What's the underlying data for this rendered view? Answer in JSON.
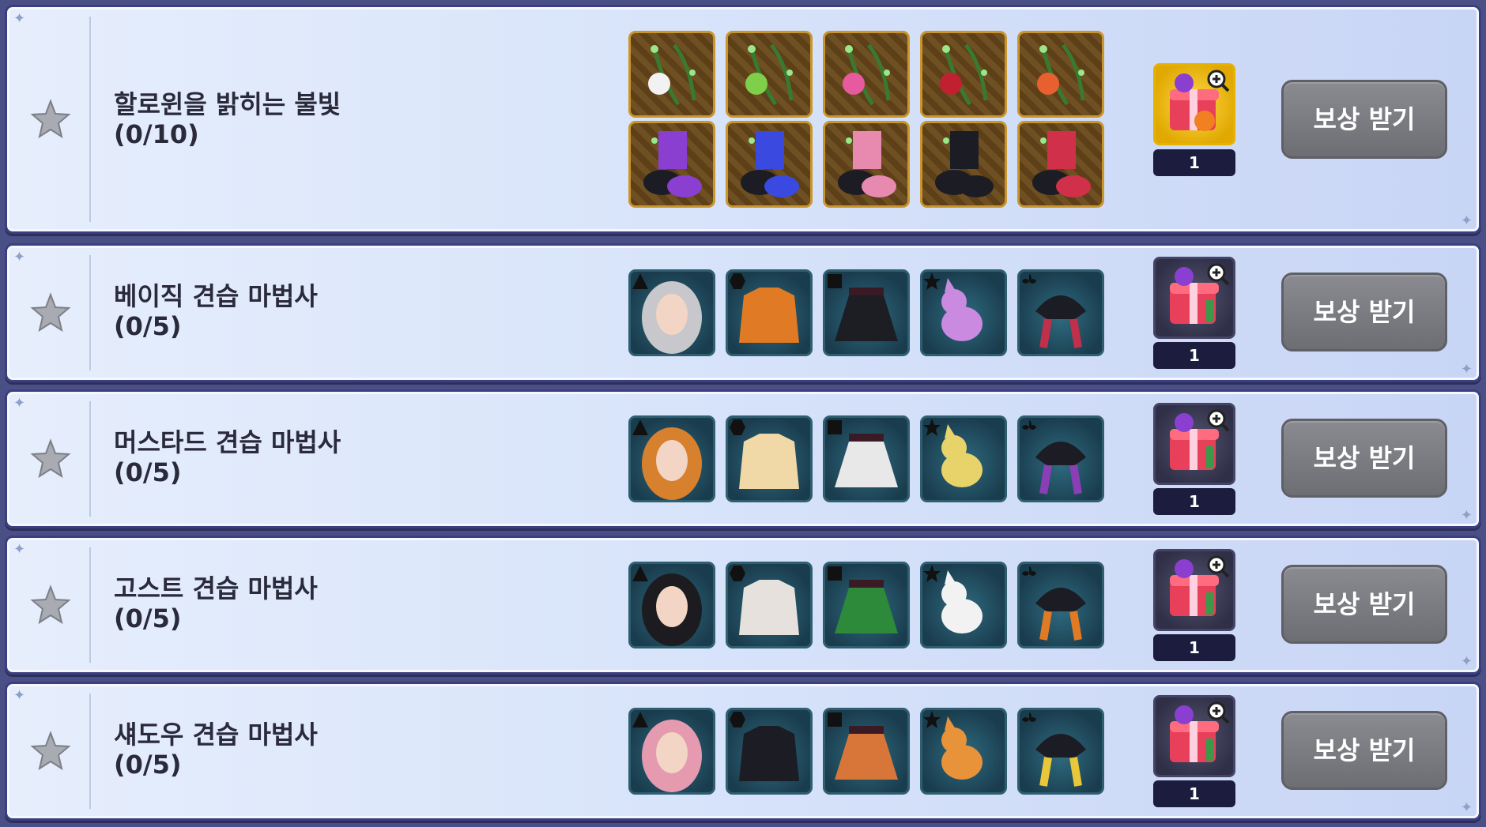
{
  "missions": [
    {
      "title": "할로윈을 밝히는 불빛",
      "progress": "(0/10)",
      "reward_count": "1",
      "claim_label": "보상 받기",
      "item_icons": [
        "lantern-vine-icon-white",
        "lantern-vine-icon-green",
        "lantern-vine-icon-pink",
        "lantern-vine-icon-red",
        "lantern-vine-icon-orange",
        "shoes-icon-purple",
        "shoes-icon-blue",
        "shoes-icon-pink",
        "shoes-icon-black",
        "shoes-icon-red"
      ],
      "reward_icon": "halloween-gift-box-icon"
    },
    {
      "title": "베이직 견습 마법사",
      "progress": "(0/5)",
      "reward_count": "1",
      "claim_label": "보상 받기",
      "item_icons": [
        "hair-icon",
        "top-icon",
        "skirt-icon",
        "pet-icon",
        "hat-icon"
      ],
      "reward_icon": "gift-box-icon"
    },
    {
      "title": "머스타드 견습 마법사",
      "progress": "(0/5)",
      "reward_count": "1",
      "claim_label": "보상 받기",
      "item_icons": [
        "hair-icon",
        "top-icon",
        "skirt-icon",
        "pet-icon",
        "hat-icon"
      ],
      "reward_icon": "gift-box-icon"
    },
    {
      "title": "고스트 견습 마법사",
      "progress": "(0/5)",
      "reward_count": "1",
      "claim_label": "보상 받기",
      "item_icons": [
        "hair-icon",
        "top-icon",
        "skirt-icon",
        "pet-icon",
        "hat-icon"
      ],
      "reward_icon": "gift-box-icon"
    },
    {
      "title": "섀도우 견습 마법사",
      "progress": "(0/5)",
      "reward_count": "1",
      "claim_label": "보상 받기",
      "item_icons": [
        "hair-icon",
        "top-icon",
        "skirt-icon",
        "pet-icon",
        "hat-icon"
      ],
      "reward_icon": "gift-box-icon"
    }
  ],
  "colors": {
    "hair": [
      "#c8c8cc",
      "#d7802e",
      "#1c1c20",
      "#e59ab0"
    ],
    "top": [
      "#e07a24",
      "#f0d9a6",
      "#e6e1dc",
      "#1c1c24"
    ],
    "skirt": [
      "#1d1d24",
      "#e8e8e8",
      "#2d8a3a",
      "#d8763a"
    ],
    "pet": [
      "#c98ae0",
      "#e8d36a",
      "#f2f2f2",
      "#e8923a"
    ],
    "hat": [
      "#c0304a",
      "#8a3fb5",
      "#e07a24",
      "#e8c83a"
    ]
  }
}
